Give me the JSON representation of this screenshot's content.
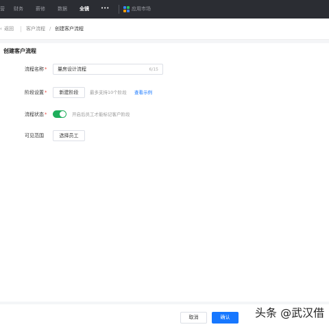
{
  "nav": {
    "items": [
      {
        "label": "营",
        "active": false
      },
      {
        "label": "财务",
        "active": false
      },
      {
        "label": "薪修",
        "active": false
      },
      {
        "label": "数据",
        "active": false
      },
      {
        "label": "全镜",
        "active": true
      },
      {
        "label": "•••",
        "active": false
      }
    ],
    "app_market": "应用市场"
  },
  "breadcrumb": {
    "back": "返回",
    "items": [
      "客户流程",
      "/",
      "创建客户流程"
    ]
  },
  "page_title": "创建客户流程",
  "form": {
    "name": {
      "label": "流程名称",
      "value": "量房设计流程",
      "counter": "6/15"
    },
    "stage": {
      "label": "阶段设置",
      "button": "新建阶段",
      "hint": "最多支持10个阶段",
      "link": "查看示例"
    },
    "status": {
      "label": "流程状态",
      "on": true,
      "hint": "开启后员工才能标记客户阶段"
    },
    "scope": {
      "label": "可见范围",
      "button": "选择员工"
    },
    "required_mark": "*"
  },
  "footer": {
    "cancel": "取消",
    "confirm": "确认"
  },
  "watermark": "头条 @武汉借",
  "colors": {
    "nav_bg": "#2b2d33",
    "primary": "#1677ff",
    "toggle_on": "#1fae5c",
    "required": "#e8453c"
  }
}
